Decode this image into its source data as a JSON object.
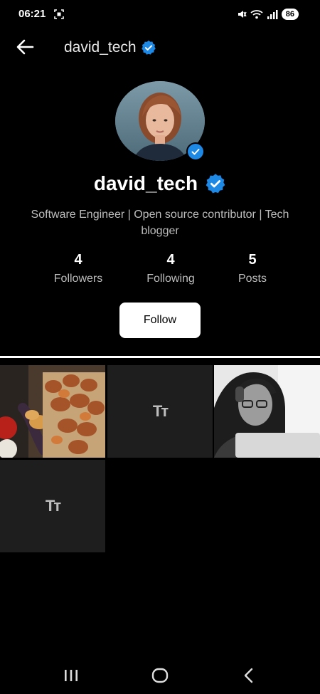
{
  "status_bar": {
    "time": "06:21",
    "battery": "86",
    "icons": [
      "screenshot-icon",
      "mute-icon",
      "wifi-icon",
      "signal-icon",
      "battery-icon"
    ]
  },
  "header": {
    "username": "david_tech",
    "back_icon": "arrow-left-icon",
    "verified_icon": "verified-badge-icon"
  },
  "profile": {
    "name": "david_tech",
    "bio": "Software Engineer | Open source contributor | Tech blogger",
    "verified_color": "#1e88e5"
  },
  "stats": {
    "followers_value": "4",
    "followers_label": "Followers",
    "following_value": "4",
    "following_label": "Following",
    "posts_value": "5",
    "posts_label": "Posts"
  },
  "follow_button": {
    "label": "Follow"
  },
  "posts": {
    "text_post_icon": "Tт",
    "items": [
      "image-post-food",
      "text-post",
      "image-post-person",
      "text-post"
    ]
  },
  "nav": {
    "icons": [
      "recent-apps-icon",
      "home-icon",
      "back-icon"
    ]
  }
}
